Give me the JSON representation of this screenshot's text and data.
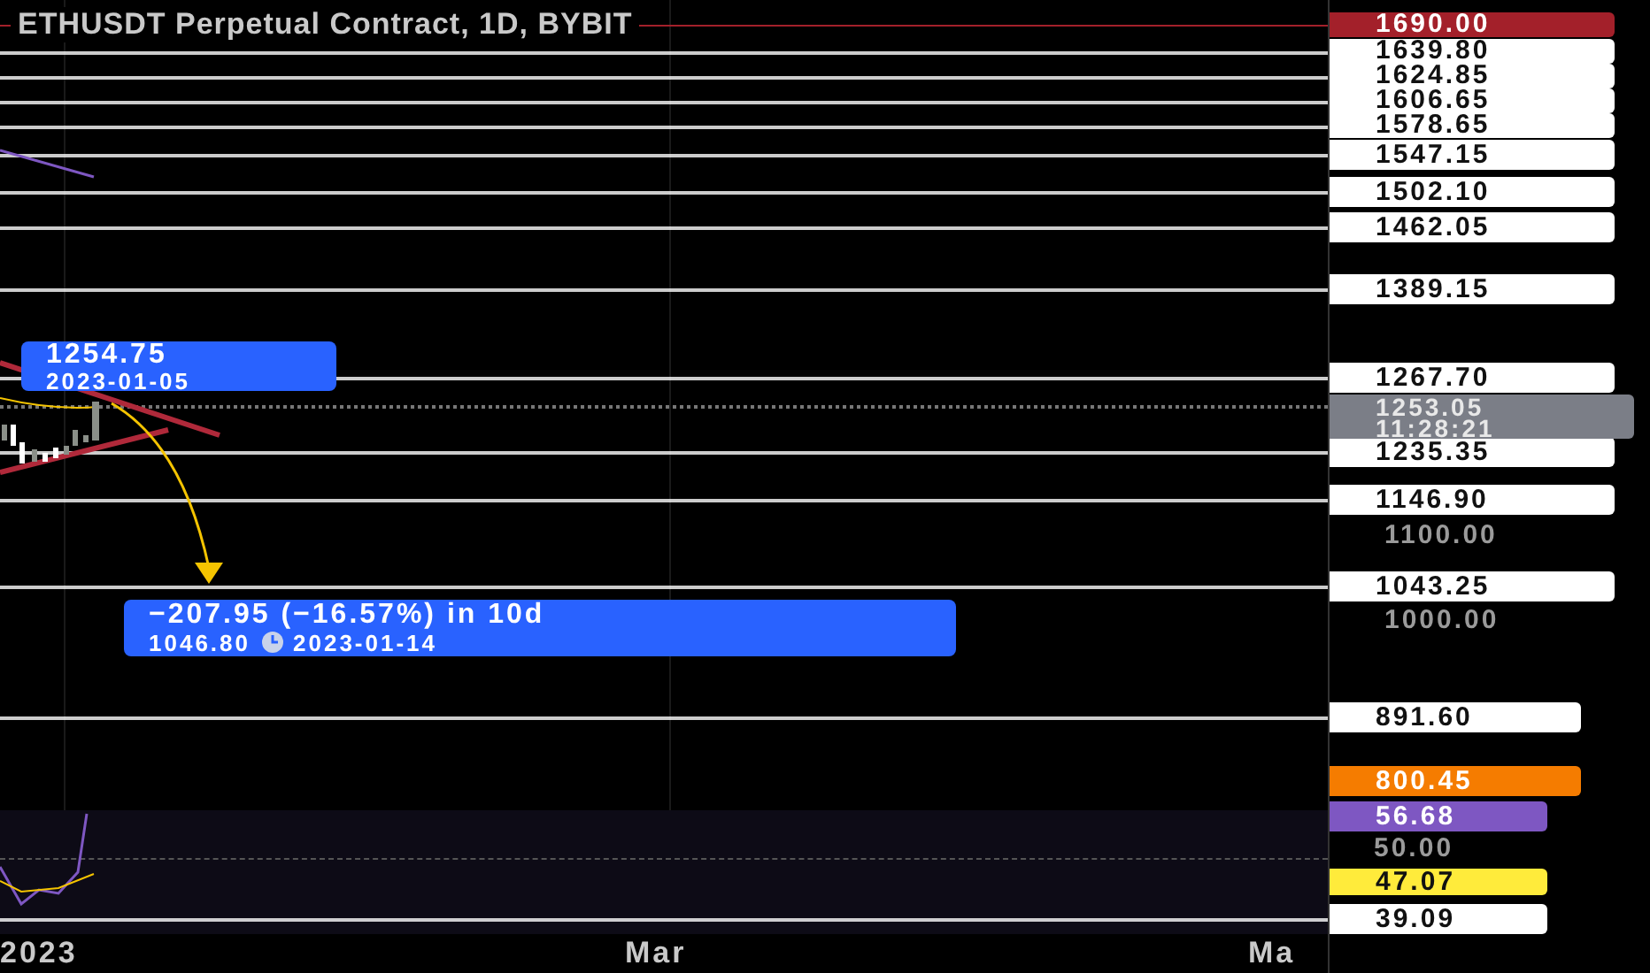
{
  "chart": {
    "title": "ETHUSDT Perpetual Contract, 1D, BYBIT",
    "price_tags": [
      {
        "text": "1690.00",
        "color": "#a3202a"
      },
      {
        "text": "1639.80",
        "color": "#ffffff"
      },
      {
        "text": "1624.85",
        "color": "#ffffff"
      },
      {
        "text": "1606.65",
        "color": "#ffffff"
      },
      {
        "text": "1578.65",
        "color": "#ffffff"
      },
      {
        "text": "1547.15",
        "color": "#ffffff"
      },
      {
        "text": "1502.10",
        "color": "#ffffff"
      },
      {
        "text": "1462.05",
        "color": "#ffffff"
      },
      {
        "text": "1389.15",
        "color": "#ffffff"
      },
      {
        "text": "1267.70",
        "color": "#ffffff"
      },
      {
        "text": "1235.35",
        "color": "#ffffff"
      },
      {
        "text": "1146.90",
        "color": "#ffffff"
      },
      {
        "text": "1043.25",
        "color": "#ffffff"
      },
      {
        "text": "891.60",
        "color": "#ffffff"
      },
      {
        "text": "800.45",
        "color": "#f57c00"
      },
      {
        "text": "56.68",
        "color": "#7e57c2"
      },
      {
        "text": "47.07",
        "color": "#ffeb3b"
      },
      {
        "text": "39.09",
        "color": "#ffffff"
      }
    ],
    "last_price": {
      "price": "1253.05",
      "countdown": "11:28:21"
    },
    "axis_ticks": [
      "1100.00",
      "1000.00",
      "50.00"
    ],
    "callouts": [
      {
        "kind": "point",
        "price": "1254.75",
        "date": "2023-01-05"
      },
      {
        "kind": "change",
        "change": "−207.95 (−16.57%) in 10d",
        "price": "1046.80",
        "date": "2023-01-14"
      }
    ],
    "time_axis": [
      "2023",
      "Mar",
      "Ma"
    ]
  }
}
